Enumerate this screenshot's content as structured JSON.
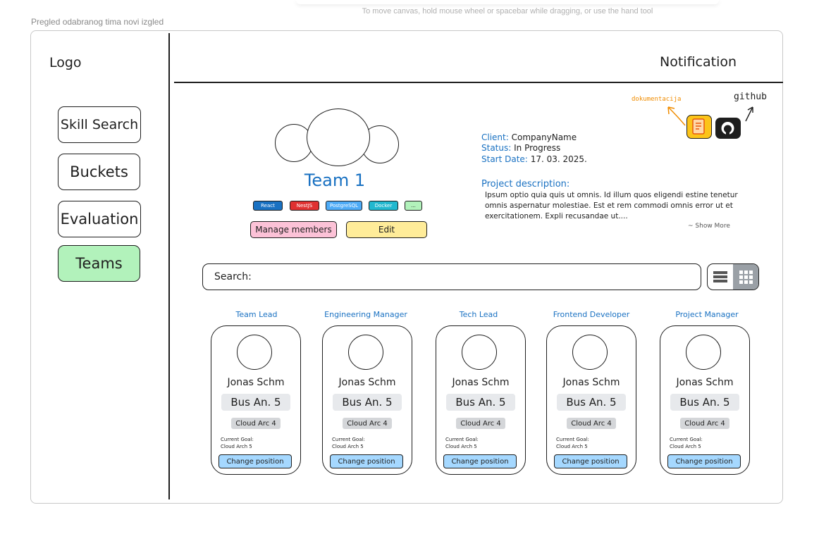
{
  "canvas_hint": "To move canvas, hold mouse wheel or spacebar while dragging, or use the hand tool",
  "frame_label": "Pregled odabranog tima novi izgled",
  "header": {
    "logo": "Logo",
    "notification": "Notification"
  },
  "sidebar": {
    "items": [
      {
        "label": "Skill Search",
        "active": false
      },
      {
        "label": "Buckets",
        "active": false
      },
      {
        "label": "Evaluation",
        "active": false
      },
      {
        "label": "Teams",
        "active": true
      }
    ]
  },
  "team": {
    "name": "Team 1",
    "tags": [
      {
        "label": "React",
        "color": "#1971c2"
      },
      {
        "label": "NestJS",
        "color": "#e03131"
      },
      {
        "label": "PostgreSQL",
        "color": "#4dabf7"
      },
      {
        "label": "Docker",
        "color": "#22b8cf"
      },
      {
        "label": "...",
        "color": "#b2f2bb"
      }
    ],
    "manage_members": "Manage members",
    "edit": "Edit"
  },
  "project": {
    "client_key": "Client:",
    "client_value": "CompanyName",
    "status_key": "Status:",
    "status_value": "In Progress",
    "start_key": "Start Date:",
    "start_value": "17. 03. 2025.",
    "description_title": "Project description:",
    "description": "Ipsum optio quia quis ut omnis. Id illum quos eligendi estine tenetur omnis aspernatur molestiae. Est et rem commodi omnis error ut et exercitationem. Expli recusandae ut....",
    "show_more": "~ Show More"
  },
  "links": {
    "documentation": "dokumentacija",
    "github": "github"
  },
  "search": {
    "label": "Search:",
    "placeholder": ""
  },
  "view_toggle": {
    "active": "grid"
  },
  "members": [
    {
      "role": "Team Lead",
      "name": "Jonas Schm",
      "position": "Bus An. 5",
      "skill": "Cloud Arc 4",
      "goal_label": "Current Goal:",
      "goal": "Cloud Arch 5",
      "button": "Change position"
    },
    {
      "role": "Engineering Manager",
      "name": "Jonas Schm",
      "position": "Bus An. 5",
      "skill": "Cloud Arc 4",
      "goal_label": "Current Goal:",
      "goal": "Cloud Arch 5",
      "button": "Change position"
    },
    {
      "role": "Tech Lead",
      "name": "Jonas Schm",
      "position": "Bus An. 5",
      "skill": "Cloud Arc 4",
      "goal_label": "Current Goal:",
      "goal": "Cloud Arch 5",
      "button": "Change position"
    },
    {
      "role": "Frontend Developer",
      "name": "Jonas Schm",
      "position": "Bus An. 5",
      "skill": "Cloud Arc 4",
      "goal_label": "Current Goal:",
      "goal": "Cloud Arch 5",
      "button": "Change position"
    },
    {
      "role": "Project Manager",
      "name": "Jonas Schm",
      "position": "Bus An. 5",
      "skill": "Cloud Arc 4",
      "goal_label": "Current Goal:",
      "goal": "Cloud Arch 5",
      "button": "Change position"
    }
  ],
  "colors": {
    "accent_blue": "#1971c2",
    "active_nav": "#b2f2bb",
    "manage_button": "#fcc2d7",
    "edit_button": "#ffec99",
    "change_button": "#a5d8ff",
    "documentation_orange": "#f08c00"
  }
}
